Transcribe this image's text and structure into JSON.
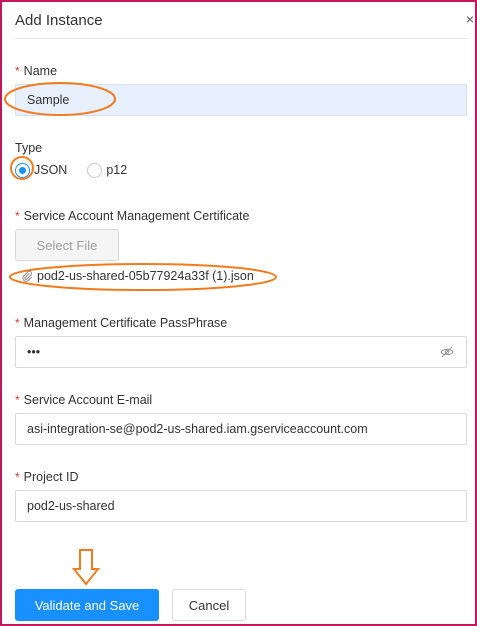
{
  "dialog": {
    "title": "Add Instance",
    "close_glyph": "×"
  },
  "form": {
    "name": {
      "required_mark": "*",
      "label": "Name",
      "value": "Sample"
    },
    "type": {
      "label": "Type",
      "options": [
        {
          "label": "JSON",
          "checked": true
        },
        {
          "label": "p12",
          "checked": false
        }
      ]
    },
    "certificate": {
      "required_mark": "*",
      "label": "Service Account Management Certificate",
      "select_button": "Select File",
      "file_name": "pod2-us-shared-05b77924a33f (1).json"
    },
    "passphrase": {
      "required_mark": "*",
      "label": "Management Certificate PassPhrase",
      "value": "•••"
    },
    "email": {
      "required_mark": "*",
      "label": "Service Account E-mail",
      "value": "asi-integration-se@pod2-us-shared.iam.gserviceaccount.com"
    },
    "project": {
      "required_mark": "*",
      "label": "Project ID",
      "value": "pod2-us-shared"
    }
  },
  "footer": {
    "validate_label": "Validate and Save",
    "cancel_label": "Cancel"
  },
  "colors": {
    "primary": "#1890ff",
    "annotation": "#f07c1e",
    "frame": "#c2185b",
    "required": "#e53935"
  },
  "icons": {
    "close": "close-icon",
    "file": "paperclip-icon",
    "visibility": "eye-slash-icon",
    "annotation_arrow": "down-arrow-icon"
  }
}
